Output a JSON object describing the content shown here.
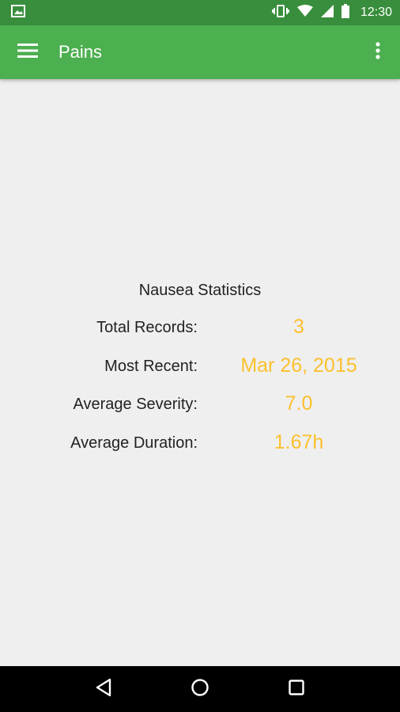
{
  "status_bar": {
    "time": "12:30",
    "icons": [
      "image-notification-icon",
      "vibrate-icon",
      "wifi-icon",
      "signal-icon",
      "battery-icon"
    ]
  },
  "app_bar": {
    "title": "Pains",
    "menu_icon": "hamburger-menu-icon",
    "overflow_icon": "more-vertical-icon"
  },
  "stats": {
    "title": "Nausea Statistics",
    "rows": [
      {
        "label": "Total Records:",
        "value": "3"
      },
      {
        "label": "Most Recent:",
        "value": "Mar 26, 2015"
      },
      {
        "label": "Average Severity:",
        "value": "7.0"
      },
      {
        "label": "Average Duration:",
        "value": "1.67h"
      }
    ]
  },
  "nav_bar": {
    "icons": [
      "back-icon",
      "home-icon",
      "recents-icon"
    ]
  },
  "colors": {
    "status_bar": "#388e3c",
    "app_bar": "#4caf50",
    "background": "#efefef",
    "value_accent": "#fbc02d"
  }
}
